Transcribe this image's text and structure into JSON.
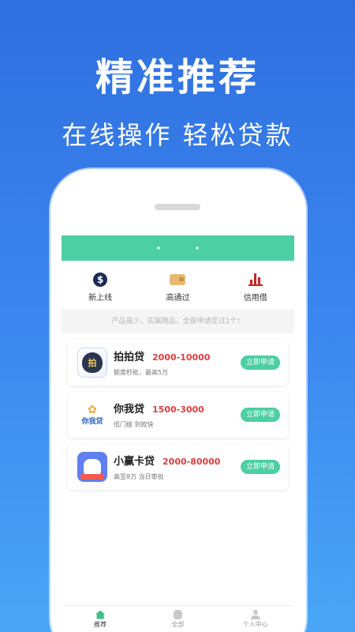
{
  "promo": {
    "headline": "精准推荐",
    "subline": "在线操作 轻松贷款"
  },
  "categories": [
    {
      "label": "新上线",
      "icon": "dollar-coin-icon"
    },
    {
      "label": "高通过",
      "icon": "wallet-icon"
    },
    {
      "label": "信用借",
      "icon": "bar-chart-icon"
    }
  ],
  "notice": "产品虽少，实属精品，全部申请定过1个！",
  "products": [
    {
      "name": "拍拍贷",
      "amount": "2000-10000",
      "desc": "额度秒批，最高5万",
      "apply": "立即申请",
      "logo_text": "拍"
    },
    {
      "name": "你我贷",
      "amount": "1500-3000",
      "desc": "低门槛 到款快",
      "apply": "立即申请",
      "logo_text": "你我贷"
    },
    {
      "name": "小赢卡贷",
      "amount": "2000-80000",
      "desc": "高至8万 当日审批",
      "apply": "立即申请",
      "logo_text": ""
    }
  ],
  "tabbar": [
    {
      "label": "推荐",
      "icon": "home-icon",
      "active": true
    },
    {
      "label": "全部",
      "icon": "money-bag-icon",
      "active": false
    },
    {
      "label": "个人中心",
      "icon": "person-icon",
      "active": false
    }
  ],
  "colors": {
    "accent": "#4ccfa2",
    "amount_red": "#e03c3c",
    "background_top": "#2f6fe0",
    "background_bottom": "#4aa6f5"
  }
}
